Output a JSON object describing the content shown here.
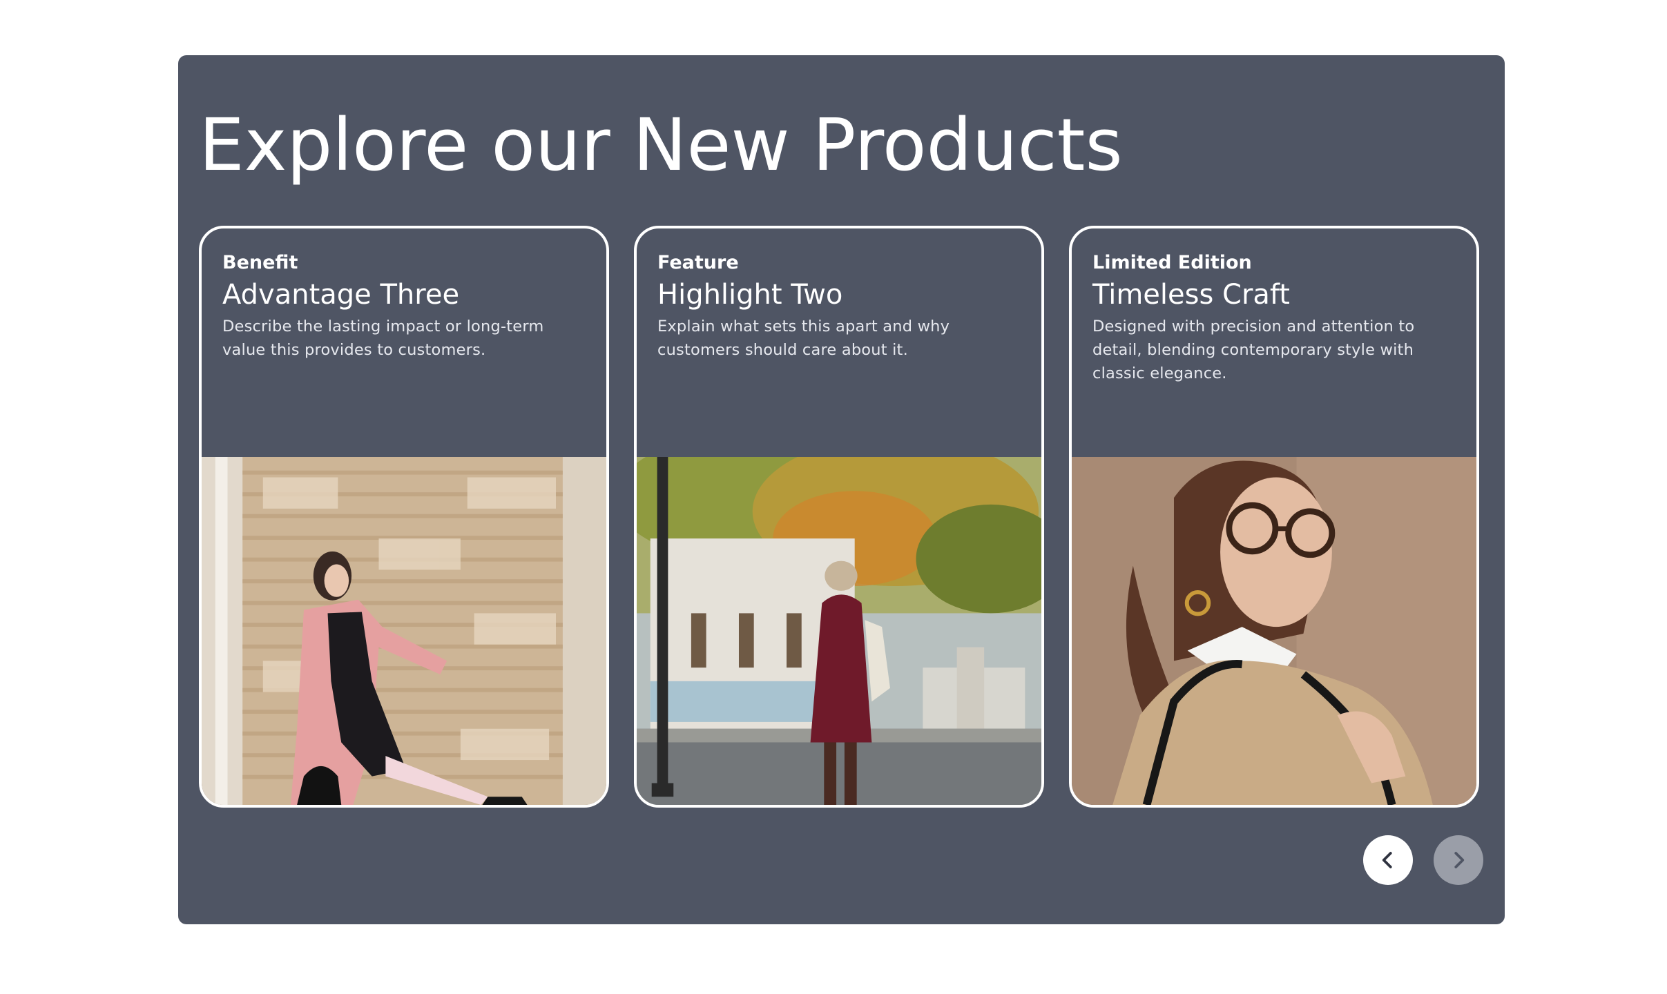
{
  "section": {
    "title": "Explore our New Products"
  },
  "cards": [
    {
      "eyebrow": "Benefit",
      "heading": "Advantage Three",
      "description": "Describe the lasting impact or long-term value this provides to customers."
    },
    {
      "eyebrow": "Feature",
      "heading": "Highlight Two",
      "description": "Explain what sets this apart and why customers should care about it."
    },
    {
      "eyebrow": "Limited Edition",
      "heading": "Timeless Craft",
      "description": "Designed with precision and attention to detail, blending contemporary style with classic elegance."
    }
  ],
  "navigation": {
    "prev_icon": "chevron-left-icon",
    "next_icon": "chevron-right-icon"
  },
  "colors": {
    "panel_background": "#4f5564",
    "card_border": "#ffffff",
    "text": "#ffffff",
    "prev_button": "#ffffff",
    "next_button": "#9a9ea8"
  }
}
